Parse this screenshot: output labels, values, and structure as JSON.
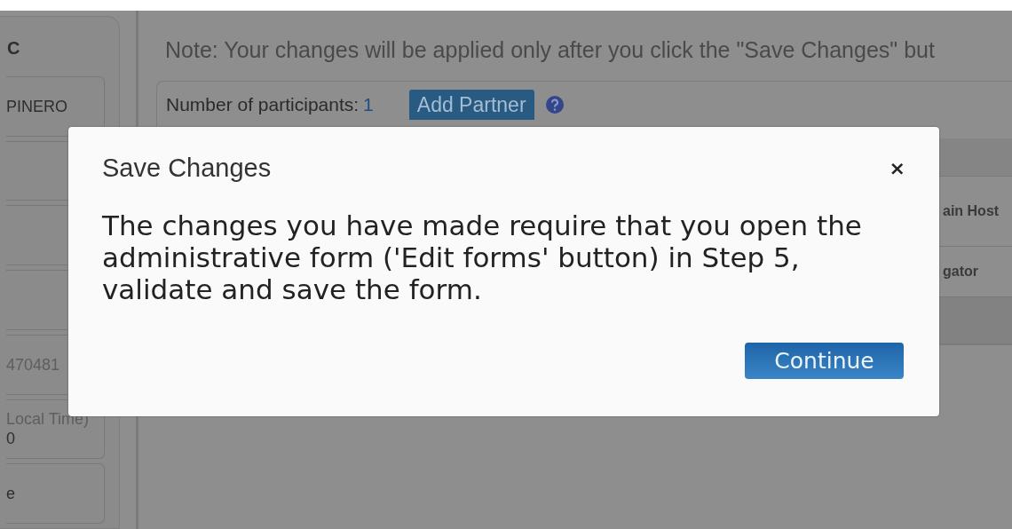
{
  "sidebar": {
    "heading": "C",
    "cards": [
      {
        "kind": "text",
        "lines": [
          "PINERO"
        ]
      },
      {
        "kind": "blank"
      },
      {
        "kind": "blank"
      },
      {
        "kind": "blank"
      },
      {
        "kind": "text",
        "lines": [
          "470481"
        ]
      },
      {
        "kind": "text",
        "lines": [
          "Local Time)",
          "0"
        ]
      },
      {
        "kind": "text",
        "lines": [
          "e"
        ]
      }
    ]
  },
  "main": {
    "note": "Note: Your changes will be applied only after you click the \"Save Changes\" but",
    "participants_label": "Number of participants:",
    "participants_count": "1",
    "add_partner_button": "Add Partner",
    "table": {
      "rows": [
        {
          "kind": "header"
        },
        {
          "kind": "row",
          "column_2": "ain Host"
        },
        {
          "kind": "row",
          "column_2": "gator"
        },
        {
          "kind": "band"
        }
      ]
    }
  },
  "dialog": {
    "title": "Save Changes",
    "close": "×",
    "message": "The changes you have made require that you open the administrative form ('Edit forms' button) in Step 5, validate and save the form.",
    "button": "Continue"
  }
}
